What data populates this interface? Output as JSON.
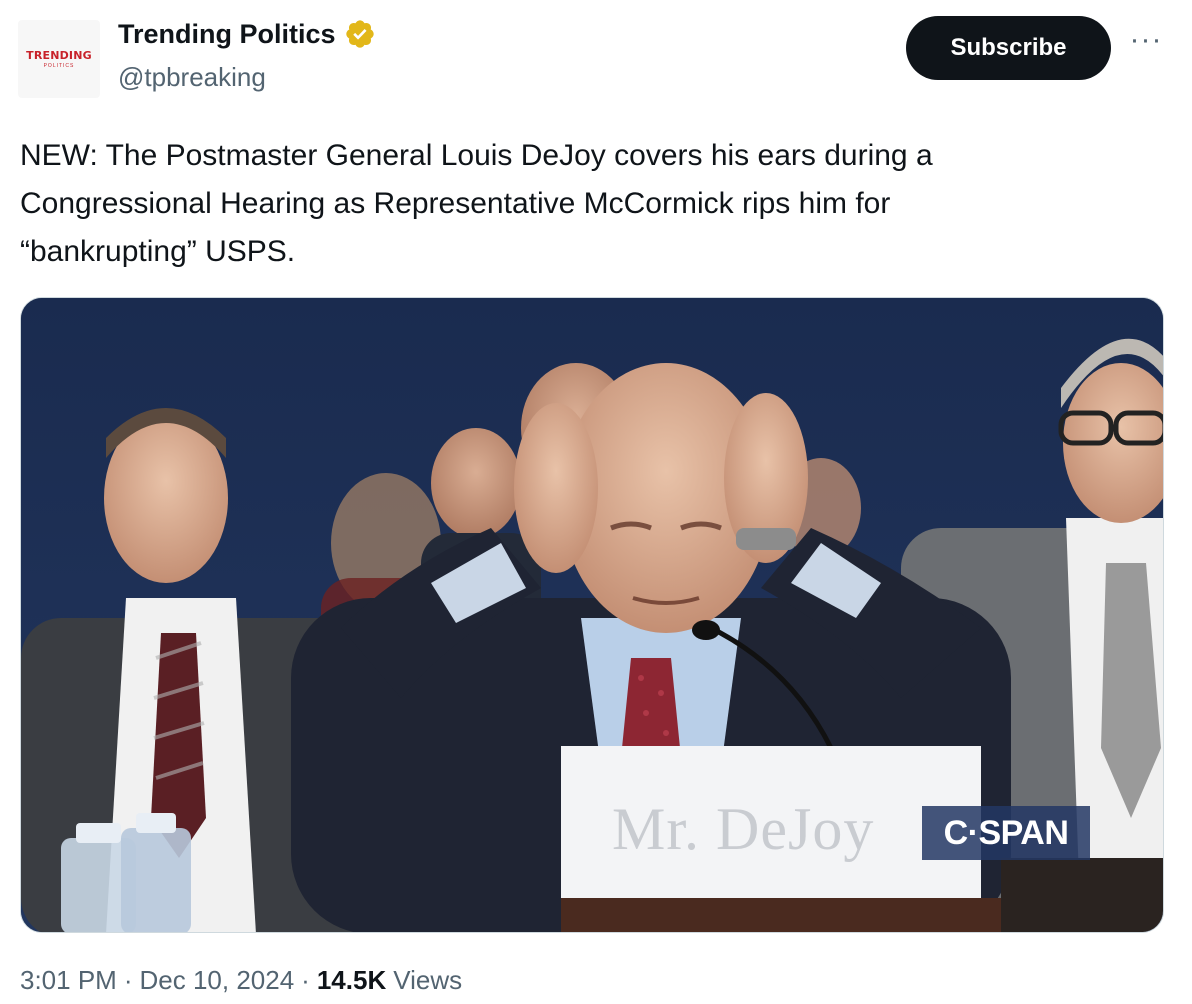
{
  "account": {
    "avatar_brand": "TRENDING",
    "avatar_sub": "POLITICS",
    "display_name": "Trending Politics",
    "handle": "@tpbreaking",
    "verified_color": "#e2b719"
  },
  "actions": {
    "subscribe_label": "Subscribe",
    "more_label": "···"
  },
  "tweet": {
    "text": "NEW: The Postmaster General Louis DeJoy covers his ears during a\nCongressional Hearing as Representative McCormick rips him for\n“bankrupting” USPS."
  },
  "media": {
    "nameplate": "Mr. DeJoy",
    "network_logo": "C·SPAN"
  },
  "meta": {
    "time": "3:01 PM",
    "separator": "·",
    "date": "Dec 10, 2024",
    "views_count": "14.5K",
    "views_label": "Views"
  }
}
